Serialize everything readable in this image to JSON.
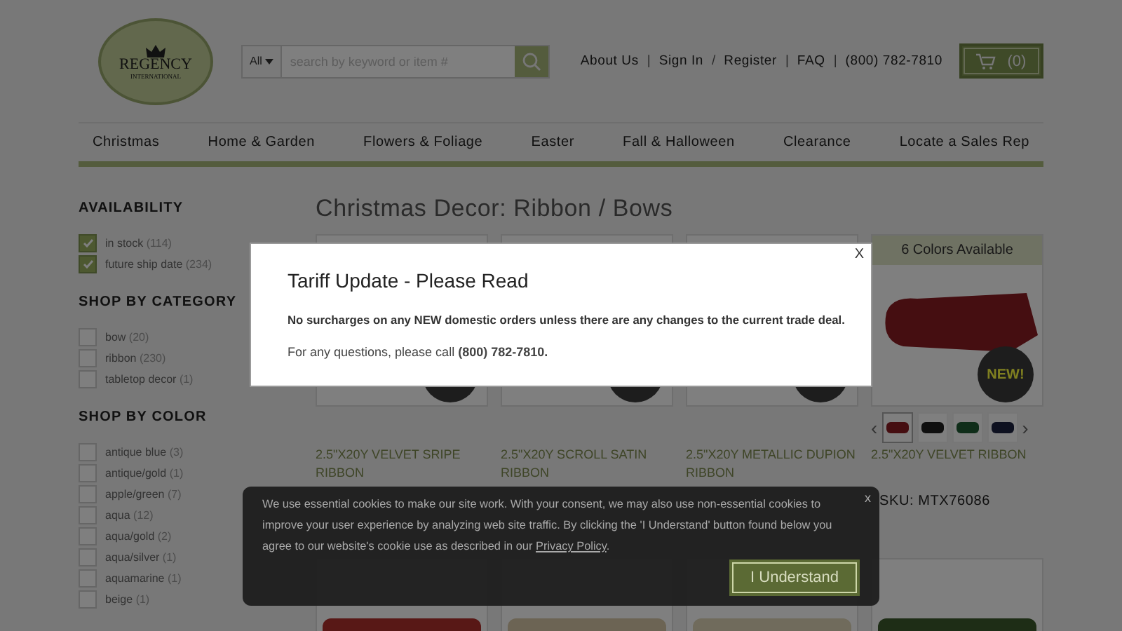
{
  "logo": {
    "name": "REGENCY",
    "tagline": "INTERNATIONAL"
  },
  "search": {
    "scope": "All",
    "placeholder": "search by keyword or item #"
  },
  "header_links": [
    {
      "kind": "link",
      "label": "About Us"
    },
    {
      "kind": "separator",
      "label": "|"
    },
    {
      "kind": "link",
      "label": "Sign In"
    },
    {
      "kind": "separator",
      "label": "/"
    },
    {
      "kind": "link",
      "label": "Register"
    },
    {
      "kind": "separator",
      "label": "|"
    },
    {
      "kind": "link",
      "label": "FAQ"
    },
    {
      "kind": "separator",
      "label": "|"
    },
    {
      "kind": "link",
      "label": "(800) 782-7810"
    }
  ],
  "cart": {
    "count": "(0)"
  },
  "nav": [
    "Christmas",
    "Home & Garden",
    "Flowers & Foliage",
    "Easter",
    "Fall & Halloween",
    "Clearance",
    "Locate a Sales Rep"
  ],
  "filters": [
    {
      "title": "AVAILABILITY",
      "items": [
        {
          "label": "in stock",
          "count": "(114)",
          "checked": true
        },
        {
          "label": "future ship date",
          "count": "(234)",
          "checked": true
        }
      ]
    },
    {
      "title": "SHOP BY CATEGORY",
      "items": [
        {
          "label": "bow",
          "count": "(20)",
          "checked": false
        },
        {
          "label": "ribbon",
          "count": "(230)",
          "checked": false
        },
        {
          "label": "tabletop decor",
          "count": "(1)",
          "checked": false
        }
      ]
    },
    {
      "title": "SHOP BY COLOR",
      "items": [
        {
          "label": "antique blue",
          "count": "(3)",
          "checked": false
        },
        {
          "label": "antique/gold",
          "count": "(1)",
          "checked": false
        },
        {
          "label": "apple/green",
          "count": "(7)",
          "checked": false
        },
        {
          "label": "aqua",
          "count": "(12)",
          "checked": false
        },
        {
          "label": "aqua/gold",
          "count": "(2)",
          "checked": false
        },
        {
          "label": "aqua/silver",
          "count": "(1)",
          "checked": false
        },
        {
          "label": "aquamarine",
          "count": "(1)",
          "checked": false
        },
        {
          "label": "beige",
          "count": "(1)",
          "checked": false
        }
      ]
    }
  ],
  "page_title": "Christmas Decor: Ribbon / Bows",
  "products": [
    {
      "name": "2.5\"X20Y VELVET SRIPE RIBBON",
      "badge": true
    },
    {
      "name": "2.5\"X20Y SCROLL SATIN RIBBON",
      "badge": true
    },
    {
      "name": "2.5\"X20Y METALLIC DUPION RIBBON",
      "badge": true
    },
    {
      "name": "2.5\"X20Y VELVET RIBBON",
      "badge": true,
      "badge_text": "NEW!",
      "colors": "6 Colors Available",
      "sku": "SKU: MTX76086",
      "prev": "‹",
      "next": "›",
      "swatches": [
        {
          "selected": true
        },
        {
          "selected": false
        },
        {
          "selected": false
        },
        {
          "selected": false
        }
      ]
    }
  ],
  "more_products": [
    {
      "kind": "photo"
    },
    {
      "kind": "photo"
    },
    {
      "kind": "photo"
    },
    {
      "kind": "photo"
    }
  ],
  "modal": {
    "title": "Tariff Update - Please Read",
    "body": "No surcharges on any NEW domestic orders unless there are any changes to the current trade deal.",
    "contact": "For any questions, please call **(800) 782-7810.**",
    "close": "X"
  },
  "cookie": {
    "text_before": "We use essential cookies to make our site work. With your consent, we may also use non-essential cookies to improve your user experience by analyzing web site traffic. By clicking the 'I Understand' button found below you agree to our website's cookie use as described in our",
    "link": "Privacy Policy",
    "text_after": ".",
    "button": "I Understand",
    "close": "x"
  }
}
